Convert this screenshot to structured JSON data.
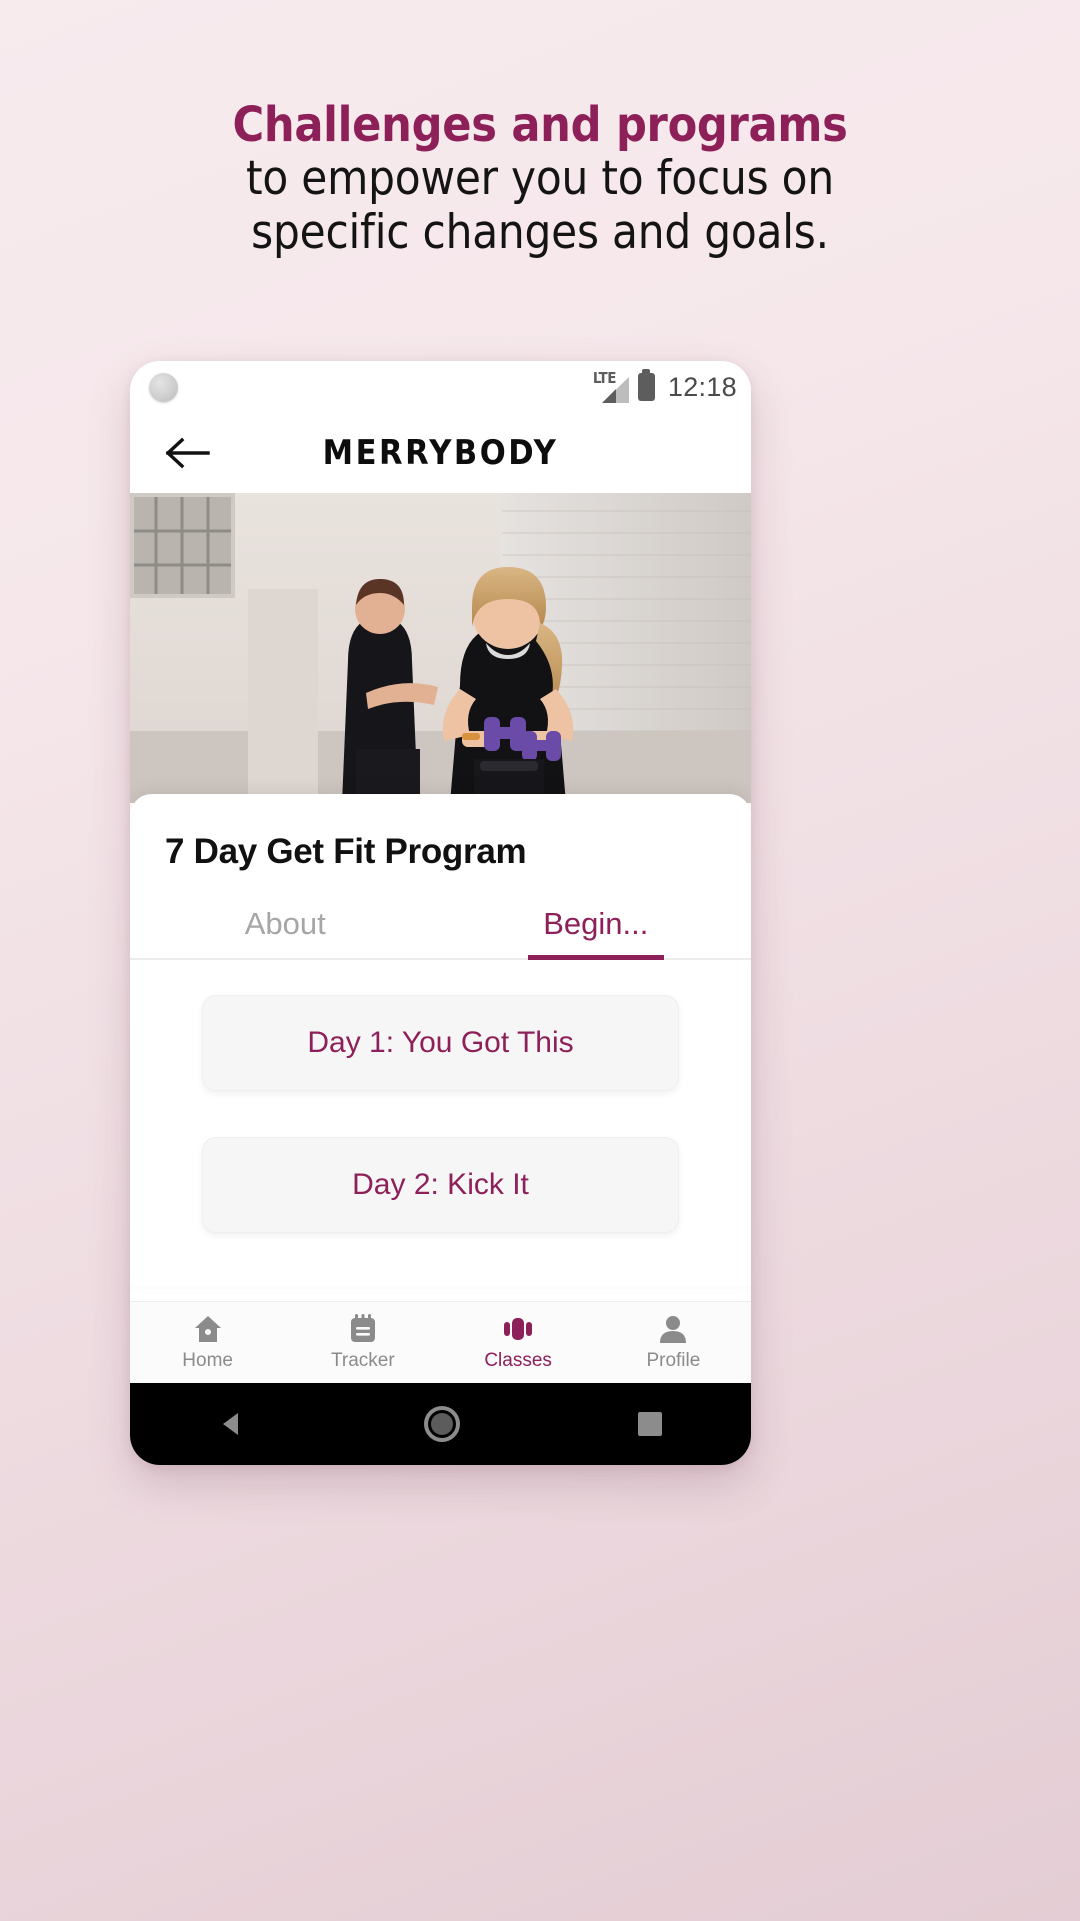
{
  "promo": {
    "line1": "Challenges and programs",
    "line2": "to empower you to focus on",
    "line3": "specific changes and goals.",
    "accent_color": "#8e2059",
    "background_color": "#f2e2e6"
  },
  "phone": {
    "status_bar": {
      "network_label": "LTE",
      "time": "12:18",
      "signal_icon": "signal-bars-icon",
      "battery_icon": "battery-full-icon",
      "camera_icon": "front-camera-icon"
    },
    "app_bar": {
      "back_icon": "back-arrow-icon",
      "title": "MERRYBODY"
    },
    "hero": {
      "alt": "two women exercising with dumbbells in a studio"
    },
    "program": {
      "title": "7 Day Get Fit Program",
      "tabs": [
        {
          "label": "About",
          "active": false
        },
        {
          "label": "Begin...",
          "active": true
        }
      ],
      "days": [
        {
          "label": "Day 1: You Got This"
        },
        {
          "label": "Day 2: Kick It"
        }
      ]
    },
    "bottom_nav": [
      {
        "label": "Home",
        "icon": "home-icon",
        "active": false
      },
      {
        "label": "Tracker",
        "icon": "tracker-icon",
        "active": false
      },
      {
        "label": "Classes",
        "icon": "classes-icon",
        "active": true
      },
      {
        "label": "Profile",
        "icon": "profile-icon",
        "active": false
      }
    ],
    "system_nav": {
      "back": "android-back-icon",
      "home": "android-home-icon",
      "recents": "android-recents-icon"
    }
  }
}
